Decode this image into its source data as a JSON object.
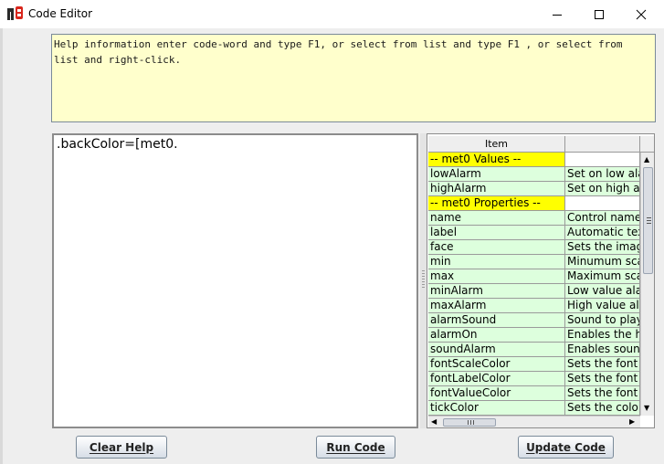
{
  "window": {
    "title": "Code Editor"
  },
  "help": {
    "text": "Help information enter code-word and type F1, or select from list and type F1 , or select from\nlist and right-click."
  },
  "editor": {
    "value": ".backColor=[met0."
  },
  "table": {
    "columns": [
      "Item",
      ""
    ],
    "rows": [
      {
        "item": "-- met0 Values --",
        "desc": "",
        "kind": "hdr"
      },
      {
        "item": "lowAlarm",
        "desc": "Set on low alarm",
        "kind": "data"
      },
      {
        "item": "highAlarm",
        "desc": "Set on high alarm",
        "kind": "data"
      },
      {
        "item": "-- met0 Properties --",
        "desc": "",
        "kind": "hdr"
      },
      {
        "item": "name",
        "desc": "Control name",
        "kind": "data"
      },
      {
        "item": "label",
        "desc": "Automatic text",
        "kind": "data"
      },
      {
        "item": "face",
        "desc": "Sets the image",
        "kind": "data"
      },
      {
        "item": "min",
        "desc": "Minumum scale",
        "kind": "data"
      },
      {
        "item": "max",
        "desc": "Maximum scale",
        "kind": "data"
      },
      {
        "item": "minAlarm",
        "desc": "Low value alarm",
        "kind": "data"
      },
      {
        "item": "maxAlarm",
        "desc": "High value alarm",
        "kind": "data"
      },
      {
        "item": "alarmSound",
        "desc": "Sound to play",
        "kind": "data"
      },
      {
        "item": "alarmOn",
        "desc": "Enables the high",
        "kind": "data"
      },
      {
        "item": "soundAlarm",
        "desc": "Enables sound",
        "kind": "data"
      },
      {
        "item": "fontScaleColor",
        "desc": "Sets the font",
        "kind": "data"
      },
      {
        "item": "fontLabelColor",
        "desc": "Sets the font",
        "kind": "data"
      },
      {
        "item": "fontValueColor",
        "desc": "Sets the font",
        "kind": "data"
      },
      {
        "item": "tickColor",
        "desc": "Sets the color",
        "kind": "data"
      }
    ]
  },
  "buttons": {
    "clear_help": "Clear Help",
    "run_code": "Run Code",
    "update_code": "Update Code"
  },
  "colors": {
    "help_bg": "#ffffcc",
    "header_row": "#ffff00",
    "data_row": "#ddffdd"
  },
  "icons": {
    "app": "app-logo-icon",
    "minimize": "minimize-icon",
    "maximize": "maximize-icon",
    "close": "close-icon"
  }
}
